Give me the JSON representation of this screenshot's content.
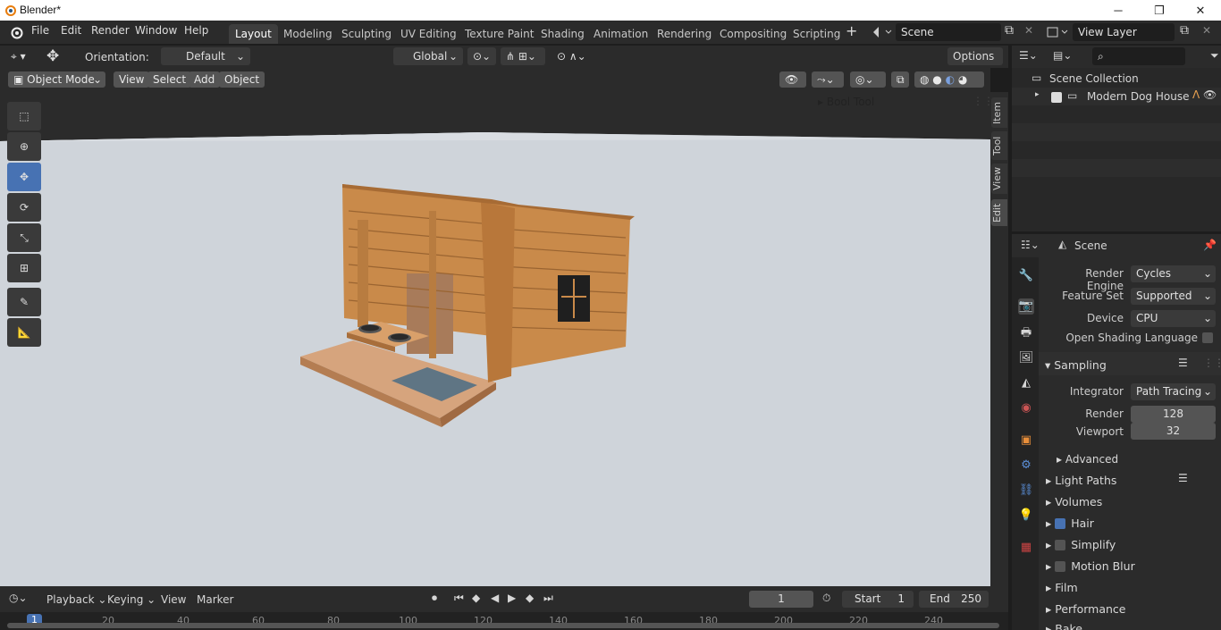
{
  "app": {
    "title": "Blender*"
  },
  "menubar": {
    "items": [
      "File",
      "Edit",
      "Render",
      "Window",
      "Help"
    ]
  },
  "workspaces": [
    "Layout",
    "Modeling",
    "Sculpting",
    "UV Editing",
    "Texture Paint",
    "Shading",
    "Animation",
    "Rendering",
    "Compositing",
    "Scripting"
  ],
  "scene_field": "Scene",
  "view_layer_field": "View Layer",
  "tool_header": {
    "orientation_label": "Orientation:",
    "orientation_value": "Default",
    "transform_orientation": "Global",
    "options": "Options"
  },
  "viewport_header": {
    "mode": "Object Mode",
    "menu": [
      "View",
      "Select",
      "Add",
      "Object"
    ]
  },
  "viewport": {
    "bool_tool": "Bool Tool",
    "side_tabs": [
      "Item",
      "Tool",
      "View",
      "Edit"
    ]
  },
  "outliner": {
    "root": "Scene Collection",
    "item": "Modern Dog House"
  },
  "properties": {
    "context": "Scene",
    "render_engine_label": "Render Engine",
    "render_engine": "Cycles",
    "feature_set_label": "Feature Set",
    "feature_set": "Supported",
    "device_label": "Device",
    "device": "CPU",
    "osl_label": "Open Shading Language",
    "sampling": "Sampling",
    "integrator_label": "Integrator",
    "integrator": "Path Tracing",
    "render_label": "Render",
    "render_samples": "128",
    "viewport_label": "Viewport",
    "viewport_samples": "32",
    "advanced": "Advanced",
    "panels": [
      "Light Paths",
      "Volumes",
      "Hair",
      "Simplify",
      "Motion Blur",
      "Film",
      "Performance",
      "Bake"
    ]
  },
  "timeline": {
    "menu": [
      "Playback",
      "Keying",
      "View",
      "Marker"
    ],
    "current_frame": "1",
    "start_label": "Start",
    "start": "1",
    "end_label": "End",
    "end": "250",
    "ruler": [
      "1",
      "20",
      "40",
      "60",
      "80",
      "100",
      "120",
      "140",
      "160",
      "180",
      "200",
      "220",
      "240"
    ]
  },
  "colors": {
    "accent": "#4772b3",
    "wood": "#c98a4a",
    "viewport_bg": "#cdd2d8"
  }
}
